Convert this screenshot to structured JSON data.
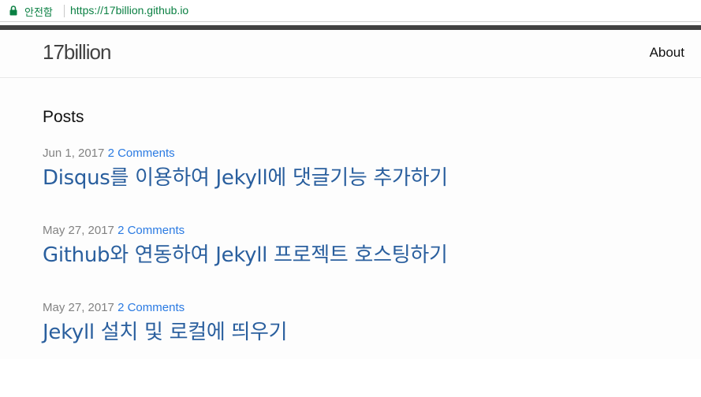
{
  "browser": {
    "security_label": "안전함",
    "url": "https://17billion.github.io",
    "secure_color": "#0b8043",
    "icon": "lock-icon"
  },
  "site": {
    "title": "17billion",
    "nav": [
      {
        "label": "About"
      }
    ]
  },
  "main": {
    "heading": "Posts",
    "posts": [
      {
        "date": "Jun 1, 2017",
        "comments": "2 Comments",
        "title": "Disqus를 이용하여 Jekyll에 댓글기능 추가하기"
      },
      {
        "date": "May 27, 2017",
        "comments": "2 Comments",
        "title": "Github와 연동하여 Jekyll 프로젝트 호스팅하기"
      },
      {
        "date": "May 27, 2017",
        "comments": "2 Comments",
        "title": "Jekyll 설치 및 로컬에 띄우기"
      }
    ]
  }
}
